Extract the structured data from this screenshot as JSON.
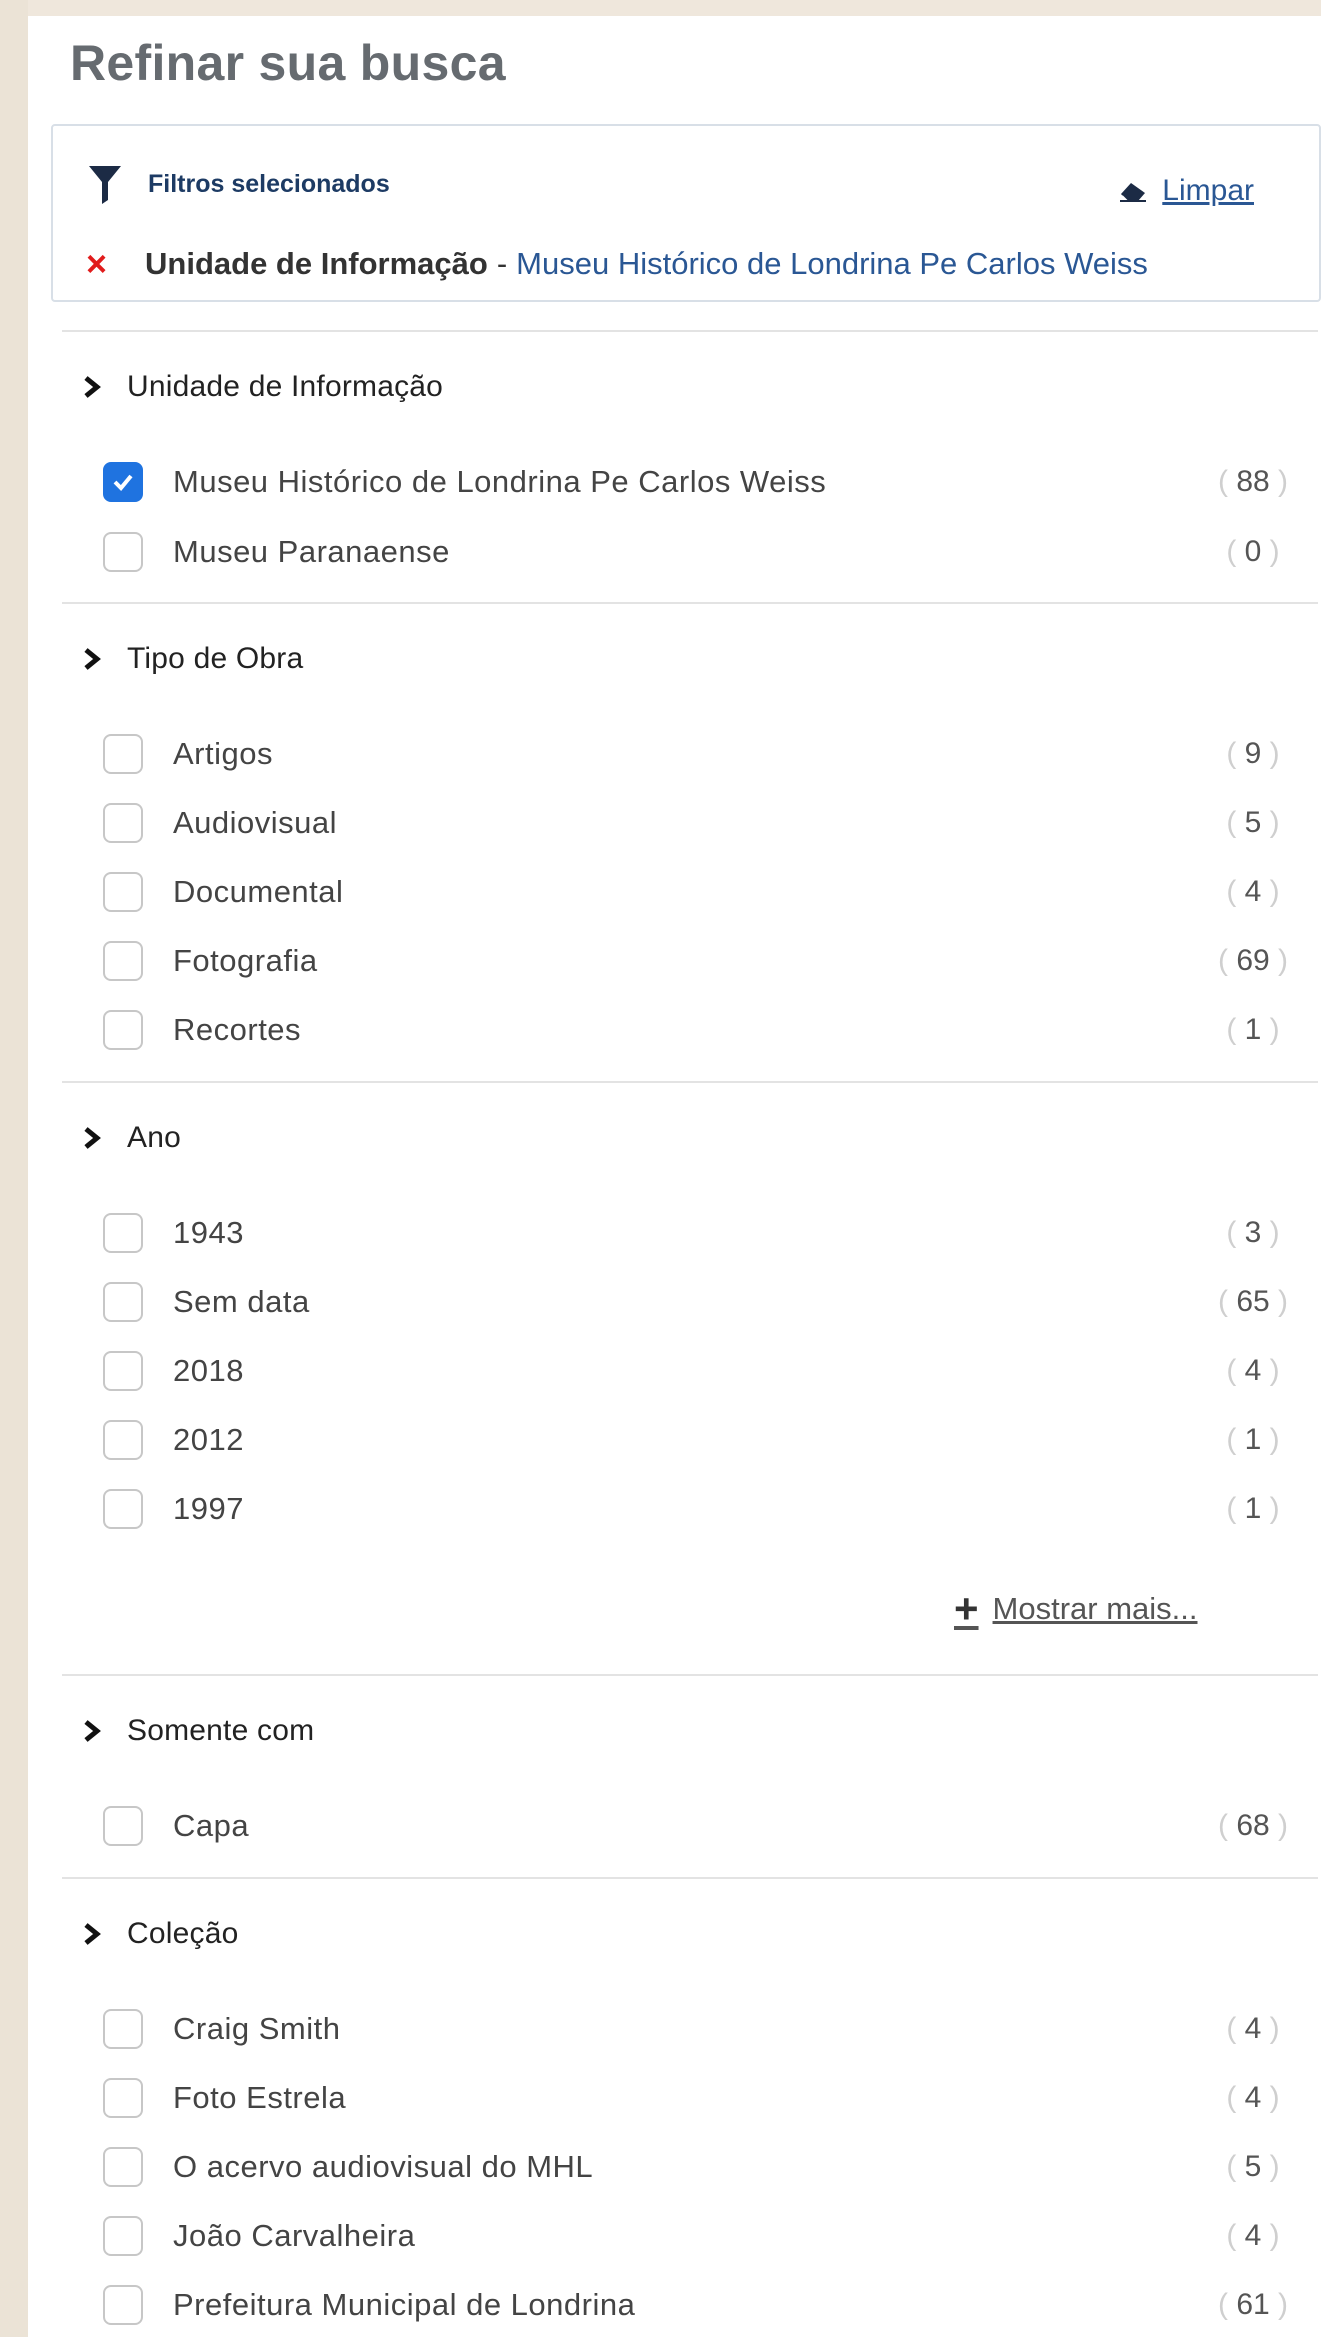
{
  "title": "Refinar sua busca",
  "selected_filters": {
    "header": "Filtros selecionados",
    "clear_label": "Limpar",
    "chip": {
      "remove": "×",
      "label": "Unidade de Informação",
      "separator": "-",
      "value": "Museu Histórico de Londrina Pe Carlos Weiss"
    }
  },
  "sections": {
    "unidade": {
      "title": "Unidade de Informação",
      "items": [
        {
          "label": "Museu Histórico de Londrina Pe Carlos Weiss",
          "count": "88",
          "checked": true
        },
        {
          "label": "Museu Paranaense",
          "count": "0",
          "checked": false
        }
      ]
    },
    "tipo": {
      "title": "Tipo de Obra",
      "items": [
        {
          "label": "Artigos",
          "count": "9"
        },
        {
          "label": "Audiovisual",
          "count": "5"
        },
        {
          "label": "Documental",
          "count": "4"
        },
        {
          "label": "Fotografia",
          "count": "69"
        },
        {
          "label": "Recortes",
          "count": "1"
        }
      ]
    },
    "ano": {
      "title": "Ano",
      "items": [
        {
          "label": "1943",
          "count": "3"
        },
        {
          "label": "Sem data",
          "count": "65"
        },
        {
          "label": "2018",
          "count": "4"
        },
        {
          "label": "2012",
          "count": "1"
        },
        {
          "label": "1997",
          "count": "1"
        }
      ],
      "show_more": "Mostrar mais..."
    },
    "somente": {
      "title": "Somente com",
      "items": [
        {
          "label": "Capa",
          "count": "68"
        }
      ]
    },
    "colecao": {
      "title": "Coleção",
      "items": [
        {
          "label": "Craig Smith",
          "count": "4"
        },
        {
          "label": "Foto Estrela",
          "count": "4"
        },
        {
          "label": "O acervo audiovisual do MHL",
          "count": "5"
        },
        {
          "label": "João Carvalheira",
          "count": "4"
        },
        {
          "label": "Prefeitura Municipal de Londrina",
          "count": "61"
        }
      ]
    }
  },
  "colors": {
    "accent": "#1f73e0",
    "link": "#2a5794",
    "remove": "#e11c1c"
  }
}
